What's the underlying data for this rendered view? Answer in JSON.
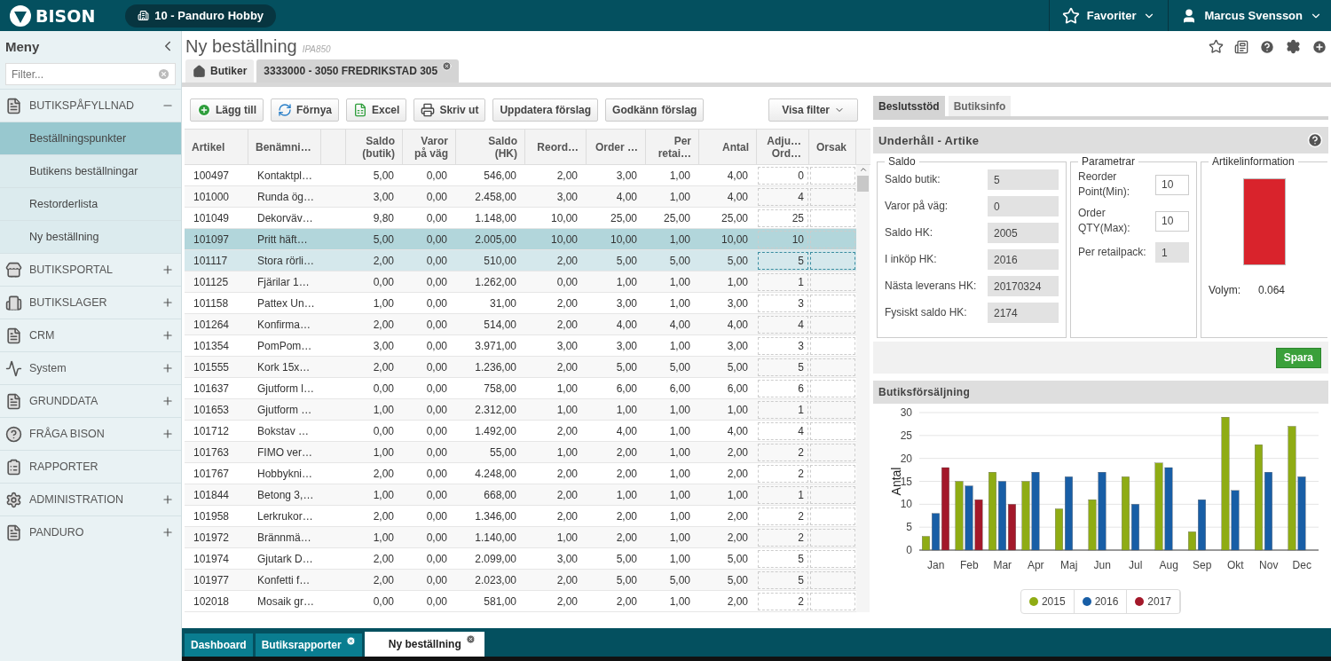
{
  "header": {
    "logo": "BISON",
    "store": "10 - Panduro Hobby",
    "favorites": "Favoriter",
    "user": "Marcus Svensson"
  },
  "sidebar": {
    "title": "Meny",
    "filter": {
      "placeholder": "Filter..."
    },
    "items": [
      {
        "label": "BUTIKSPÅFYLLNAD",
        "expandable": true,
        "expanded": true,
        "children": [
          {
            "label": "Beställningspunkter",
            "selected": true
          },
          {
            "label": "Butikens beställningar",
            "selected": false
          },
          {
            "label": "Restorderlista",
            "selected": false
          },
          {
            "label": "Ny beställning",
            "selected": false
          }
        ]
      },
      {
        "label": "BUTIKSPORTAL",
        "expandable": true,
        "expanded": false
      },
      {
        "label": "BUTIKSLAGER",
        "expandable": true,
        "expanded": false
      },
      {
        "label": "CRM",
        "expandable": true,
        "expanded": false
      },
      {
        "label": "System",
        "expandable": true,
        "expanded": false
      },
      {
        "label": "GRUNDDATA",
        "expandable": true,
        "expanded": false
      },
      {
        "label": "FRÅGA BISON",
        "expandable": true,
        "expanded": false
      },
      {
        "label": "RAPPORTER",
        "expandable": false
      },
      {
        "label": "ADMINISTRATION",
        "expandable": true,
        "expanded": false
      },
      {
        "label": "PANDURO",
        "expandable": true,
        "expanded": false
      }
    ]
  },
  "page": {
    "title": "Ny beställning",
    "code": "IPA850"
  },
  "breadcrumbs": [
    {
      "label": "Butiker",
      "selected": false,
      "closable": false
    },
    {
      "label": "3333000 - 3050 FREDRIKSTAD 305",
      "selected": true,
      "closable": true
    }
  ],
  "toolbar": {
    "buttons": [
      "Lägg till",
      "Förnya",
      "Excel",
      "Skriv ut",
      "Uppdatera förslag",
      "Godkänn förslag"
    ],
    "filter_button": "Visa filter"
  },
  "table": {
    "columns": [
      "Artikel",
      "Benämni…",
      "Saldo\n(butik)",
      "Varor\npå väg",
      "Saldo\n(HK)",
      "Reord…",
      "Order …",
      "Per\nretai…",
      "Antal",
      "Adju…\nOrd…",
      "Orsak"
    ],
    "rows": [
      {
        "cells": [
          "100497",
          "Kontaktpl…",
          "5,00",
          "0,00",
          "546,00",
          "2,00",
          "3,00",
          "1,00",
          "4,00"
        ],
        "adjusted": "0",
        "selected": false,
        "focused": false
      },
      {
        "cells": [
          "101000",
          "Runda ög…",
          "3,00",
          "0,00",
          "2.458,00",
          "3,00",
          "4,00",
          "1,00",
          "4,00"
        ],
        "adjusted": "4",
        "selected": false,
        "focused": false
      },
      {
        "cells": [
          "101049",
          "Dekorväv…",
          "9,80",
          "0,00",
          "1.148,00",
          "10,00",
          "25,00",
          "25,00",
          "25,00"
        ],
        "adjusted": "25",
        "selected": false,
        "focused": false
      },
      {
        "cells": [
          "101097",
          "Pritt häft…",
          "5,00",
          "0,00",
          "2.005,00",
          "10,00",
          "10,00",
          "1,00",
          "10,00"
        ],
        "adjusted": "10",
        "selected": true,
        "focused": false
      },
      {
        "cells": [
          "101117",
          "Stora rörli…",
          "2,00",
          "0,00",
          "510,00",
          "2,00",
          "5,00",
          "5,00",
          "5,00"
        ],
        "adjusted": "5",
        "selected": false,
        "focused": true
      },
      {
        "cells": [
          "101125",
          "Fjärilar 1…",
          "0,00",
          "0,00",
          "1.262,00",
          "0,00",
          "1,00",
          "1,00",
          "1,00"
        ],
        "adjusted": "1",
        "selected": false,
        "focused": false
      },
      {
        "cells": [
          "101158",
          "Pattex Un…",
          "1,00",
          "0,00",
          "31,00",
          "2,00",
          "3,00",
          "1,00",
          "3,00"
        ],
        "adjusted": "3",
        "selected": false,
        "focused": false
      },
      {
        "cells": [
          "101264",
          "Konfirma…",
          "2,00",
          "0,00",
          "514,00",
          "2,00",
          "4,00",
          "4,00",
          "4,00"
        ],
        "adjusted": "4",
        "selected": false,
        "focused": false
      },
      {
        "cells": [
          "101354",
          "PomPom…",
          "3,00",
          "0,00",
          "3.971,00",
          "3,00",
          "3,00",
          "1,00",
          "3,00"
        ],
        "adjusted": "3",
        "selected": false,
        "focused": false
      },
      {
        "cells": [
          "101555",
          "Kork 15x…",
          "2,00",
          "0,00",
          "1.236,00",
          "2,00",
          "5,00",
          "5,00",
          "5,00"
        ],
        "adjusted": "5",
        "selected": false,
        "focused": false
      },
      {
        "cells": [
          "101637",
          "Gjutform l…",
          "0,00",
          "0,00",
          "758,00",
          "1,00",
          "6,00",
          "6,00",
          "6,00"
        ],
        "adjusted": "6",
        "selected": false,
        "focused": false
      },
      {
        "cells": [
          "101653",
          "Gjutform …",
          "1,00",
          "0,00",
          "2.312,00",
          "1,00",
          "1,00",
          "1,00",
          "1,00"
        ],
        "adjusted": "1",
        "selected": false,
        "focused": false
      },
      {
        "cells": [
          "101712",
          "Bokstav …",
          "0,00",
          "0,00",
          "1.492,00",
          "2,00",
          "4,00",
          "1,00",
          "4,00"
        ],
        "adjusted": "4",
        "selected": false,
        "focused": false
      },
      {
        "cells": [
          "101763",
          "FIMO ver…",
          "1,00",
          "0,00",
          "55,00",
          "1,00",
          "2,00",
          "1,00",
          "2,00"
        ],
        "adjusted": "2",
        "selected": false,
        "focused": false
      },
      {
        "cells": [
          "101767",
          "Hobbykni…",
          "2,00",
          "0,00",
          "4.248,00",
          "2,00",
          "2,00",
          "1,00",
          "2,00"
        ],
        "adjusted": "2",
        "selected": false,
        "focused": false
      },
      {
        "cells": [
          "101844",
          "Betong 3,…",
          "1,00",
          "0,00",
          "668,00",
          "2,00",
          "1,00",
          "1,00",
          "1,00"
        ],
        "adjusted": "1",
        "selected": false,
        "focused": false
      },
      {
        "cells": [
          "101958",
          "Lerkrukor…",
          "2,00",
          "0,00",
          "1.346,00",
          "2,00",
          "2,00",
          "1,00",
          "2,00"
        ],
        "adjusted": "2",
        "selected": false,
        "focused": false
      },
      {
        "cells": [
          "101972",
          "Brännmä…",
          "1,00",
          "0,00",
          "1.140,00",
          "1,00",
          "2,00",
          "1,00",
          "2,00"
        ],
        "adjusted": "2",
        "selected": false,
        "focused": false
      },
      {
        "cells": [
          "101974",
          "Gjutark D…",
          "2,00",
          "0,00",
          "2.099,00",
          "3,00",
          "5,00",
          "1,00",
          "5,00"
        ],
        "adjusted": "5",
        "selected": false,
        "focused": false
      },
      {
        "cells": [
          "101977",
          "Konfetti f…",
          "2,00",
          "0,00",
          "2.023,00",
          "2,00",
          "5,00",
          "5,00",
          "5,00"
        ],
        "adjusted": "5",
        "selected": false,
        "focused": false
      },
      {
        "cells": [
          "102018",
          "Mosaik gr…",
          "0,00",
          "0,00",
          "581,00",
          "2,00",
          "2,00",
          "1,00",
          "2,00"
        ],
        "adjusted": "2",
        "selected": false,
        "focused": false
      }
    ]
  },
  "detail": {
    "tabs": [
      {
        "label": "Beslutsstöd",
        "selected": true
      },
      {
        "label": "Butiksinfo",
        "selected": false
      }
    ],
    "section_title": "Underhåll - Artike",
    "saldo": {
      "title": "Saldo",
      "fields": [
        {
          "label": "Saldo butik:",
          "value": "5"
        },
        {
          "label": "Varor på väg:",
          "value": "0"
        },
        {
          "label": "Saldo HK:",
          "value": "2005"
        },
        {
          "label": "I inköp HK:",
          "value": "2016"
        },
        {
          "label": "Nästa leverans HK:",
          "value": "20170324"
        },
        {
          "label": "Fysiskt saldo HK:",
          "value": "2174"
        }
      ]
    },
    "parameters": {
      "title": "Parametrar",
      "fields": [
        {
          "label": "Reorder Point(Min):",
          "value": "10",
          "editable": true
        },
        {
          "label": "Order QTY(Max):",
          "value": "10",
          "editable": true
        },
        {
          "label": "Per retailpack:",
          "value": "1",
          "editable": false
        }
      ]
    },
    "article_info": {
      "title": "Artikelinformation",
      "volume_label": "Volym:",
      "volume": "0.064"
    },
    "save_button": "Spara"
  },
  "sales": {
    "title": "Butiksförsäljning",
    "chart_data": {
      "type": "bar",
      "ylabel": "Antal",
      "categories": [
        "Jan",
        "Feb",
        "Mar",
        "Apr",
        "Maj",
        "Jun",
        "Jul",
        "Aug",
        "Sep",
        "Okt",
        "Nov",
        "Dec"
      ],
      "series": [
        {
          "name": "2015",
          "color": "#8fac14",
          "values": [
            3,
            15,
            17,
            15,
            9,
            11,
            16,
            19,
            4,
            29,
            23,
            27
          ]
        },
        {
          "name": "2016",
          "color": "#185ea6",
          "values": [
            8,
            14,
            15,
            17,
            16,
            17,
            10,
            18,
            11,
            13,
            17,
            16
          ]
        },
        {
          "name": "2017",
          "color": "#a3182a",
          "values": [
            18,
            11,
            10,
            null,
            null,
            null,
            null,
            null,
            null,
            null,
            null,
            null
          ]
        }
      ],
      "ylim": [
        0,
        30
      ],
      "yticks": [
        0,
        5,
        10,
        15,
        20,
        25,
        30
      ],
      "grid": true,
      "legend": "bottom"
    }
  },
  "bottom_tabs": [
    {
      "label": "Dashboard",
      "selected": false,
      "closable": false
    },
    {
      "label": "Butiksrapporter",
      "selected": false,
      "closable": true
    },
    {
      "label": "Ny beställning",
      "selected": true,
      "closable": true
    }
  ]
}
